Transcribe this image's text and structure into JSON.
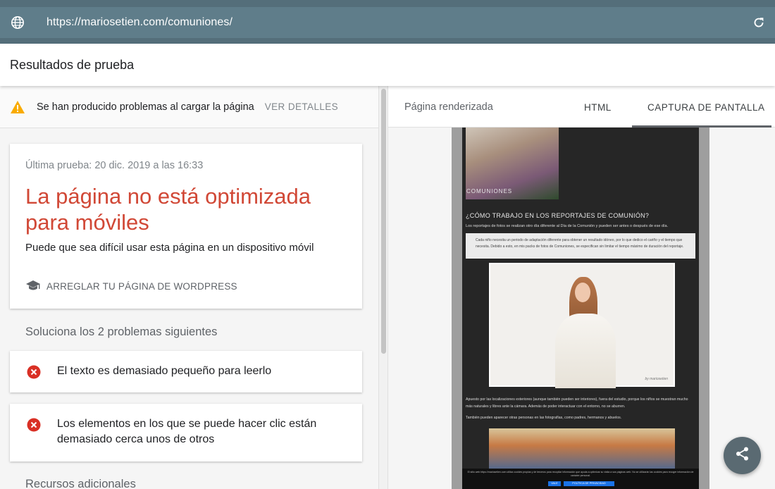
{
  "browser": {
    "url": "https://mariosetien.com/comuniones/",
    "globe_icon": "globe-icon",
    "refresh_icon": "refresh-icon"
  },
  "header": {
    "title": "Resultados de prueba"
  },
  "warning": {
    "icon": "warning-icon",
    "text": "Se han producido problemas al cargar la página",
    "link": "VER DETALLES",
    "color": "#f9ab00"
  },
  "summary": {
    "last_test": "Última prueba: 20 dic. 2019 a las 16:33",
    "verdict": "La página no está optimizada para móviles",
    "verdict_color": "#d14836",
    "subtitle": "Puede que sea difícil usar esta página en un dispositivo móvil",
    "fix_icon": "graduation-cap-icon",
    "fix_link": "ARREGLAR TU PÁGINA DE WORDPRESS"
  },
  "problems": {
    "title": "Soluciona los 2 problemas siguientes",
    "items": [
      {
        "icon": "error-icon",
        "text": "El texto es demasiado pequeño para leerlo"
      },
      {
        "icon": "error-icon",
        "text": "Los elementos en los que se puede hacer clic están demasiado cerca unos de otros"
      }
    ]
  },
  "resources": {
    "title": "Recursos adicionales"
  },
  "right_panel": {
    "label": "Página renderizada",
    "tabs": [
      {
        "label": "HTML",
        "active": false
      },
      {
        "label": "CAPTURA DE PANTALLA",
        "active": true
      }
    ]
  },
  "screenshot": {
    "photo_caption": "COMUNIONES",
    "heading": "¿CÓMO TRABAJO EN LOS REPORTAJES DE COMUNIÓN?",
    "para1": "Los reportajes de fotos se realizan otro día diferente al Día de la Comunión y pueden ser antes o después de ese día.",
    "quote": "Cada niño necesita un periodo de adaptación diferente para obtener un resultado idóneo, por lo que dedico el cariño y el tiempo que necesita. Debido a esto, en mis packs de fotos de Comuniones, se especifican sin limitar el tiempo máximo de duración del reportaje.",
    "photo_signature": "by mariosetien",
    "para2": "Apuesto por las localizaciones exteriores (aunque también pueden ser interiores), fuera del estudio, porque los niños se muestran mucho más naturales y libres ante la cámara. Además de poder interactuar con el entorno, no se aburren.",
    "para3": "También pueden aparecer otras personas en las fotografías, como padres, hermanos y abuelos.",
    "cookie_text": "El sitio web https://mariosetien.com utiliza cookies propias y de terceros para recopilar información que ayuda a optimizar su visita a sus páginas web. No se utilizarán las cookies para recoger información de carácter personal.",
    "cookie_accept": "VALE",
    "cookie_policy": "POLÍTICA DE PRIVACIDAD"
  },
  "fab": {
    "icon": "share-icon"
  }
}
